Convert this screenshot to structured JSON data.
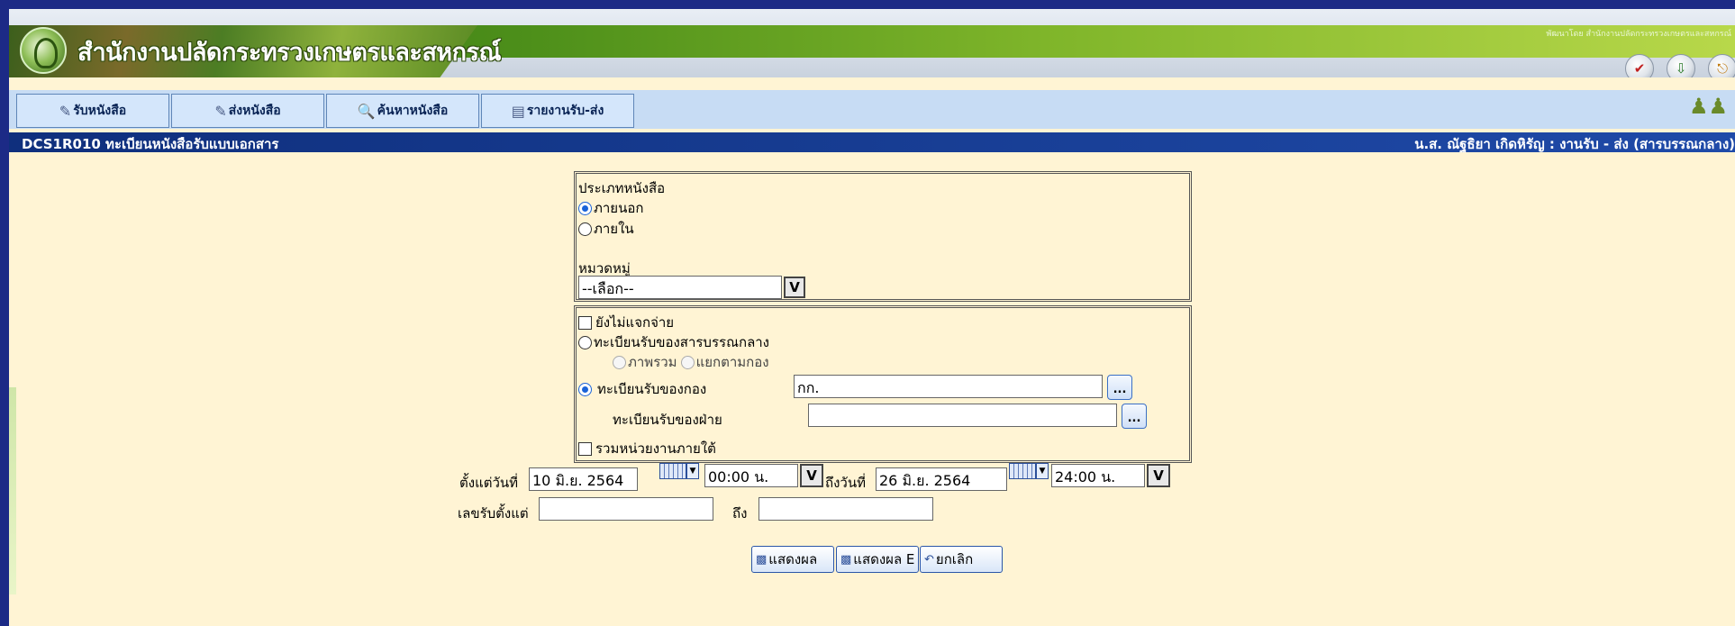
{
  "header": {
    "org_name": "สำนักงานปลัดกระทรวงเกษตรและสหกรณ์",
    "dev_credit": "พัฒนาโดย สำนักงานปลัดกระทรวงเกษตรและสหกรณ์",
    "icons": [
      "pdf-icon",
      "download-icon",
      "exit-icon"
    ]
  },
  "nav": {
    "items": [
      {
        "label": "รับหนังสือ",
        "icon": "receive-icon"
      },
      {
        "label": "ส่งหนังสือ",
        "icon": "send-icon"
      },
      {
        "label": "ค้นหาหนังสือ",
        "icon": "search-icon"
      },
      {
        "label": "รายงานรับ-ส่ง",
        "icon": "report-icon"
      }
    ]
  },
  "titlebar": {
    "page_title": "DCS1R010 ทะเบียนหนังสือรับแบบเอกสาร",
    "user_info": "น.ส. ณัฐธิยา เกิดหิรัญ : งานรับ - ส่ง (สารบรรณกลาง)"
  },
  "form": {
    "doc_type": {
      "heading": "ประเภทหนังสือ",
      "options": [
        "ภายนอก",
        "ภายใน"
      ],
      "selected": "ภายนอก"
    },
    "category": {
      "label": "หมวดหมู่",
      "value": "--เลือก--",
      "button": "V"
    },
    "not_distributed_label": "ยังไม่แจกจ่าย",
    "central_registry_label": "ทะเบียนรับของสารบรรณกลาง",
    "central_suboptions": [
      "ภาพรวม",
      "แยกตามกอง"
    ],
    "division_registry_label": "ทะเบียนรับของกอง",
    "division_value": "กก.",
    "section_registry_label": "ทะเบียนรับของฝ่าย",
    "section_value": "",
    "include_sub_units_label": "รวมหน่วยงานภายใต้",
    "lookup_button": "...",
    "date_from_label": "ตั้งแต่วันที่",
    "date_from_value": "10 มิ.ย. 2564",
    "time_from_value": "00:00 น.",
    "date_to_label": "ถึงวันที่",
    "date_to_value": "26 มิ.ย. 2564",
    "time_to_value": "24:00 น.",
    "time_button": "V",
    "receive_no_from_label": "เลขรับตั้งแต่",
    "receive_no_from_value": "",
    "receive_no_to_label": "ถึง",
    "receive_no_to_value": ""
  },
  "actions": {
    "show_label": "แสดงผล",
    "show_excel_label": "แสดงผล E",
    "cancel_label": "ยกเลิก"
  },
  "colors": {
    "frame": "#1c2a86",
    "background": "#fff4d4",
    "titlebar": "#1f4aa8",
    "nav": "#c7dcf4",
    "radio_accent": "#1a63d8"
  }
}
